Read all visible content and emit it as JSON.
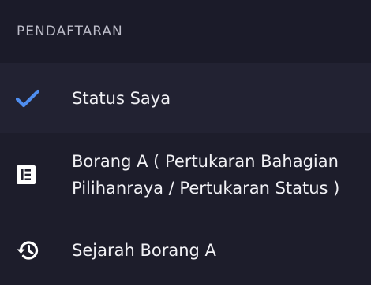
{
  "section": {
    "title": "PENDAFTARAN"
  },
  "menu": {
    "items": [
      {
        "label": "Status Saya",
        "icon": "check-icon",
        "state": "active"
      },
      {
        "label": "Borang A ( Pertukaran Bahagian Pilihanraya / Pertukaran Status )",
        "icon": "form-list-icon",
        "state": "default"
      },
      {
        "label": "Sejarah Borang A",
        "icon": "history-icon",
        "state": "default"
      }
    ]
  },
  "colors": {
    "background": "#1d1d2b",
    "active_background": "#222232",
    "accent": "#4f8ef0",
    "text": "#f1f1f5",
    "header_text": "#bdbdc9"
  }
}
